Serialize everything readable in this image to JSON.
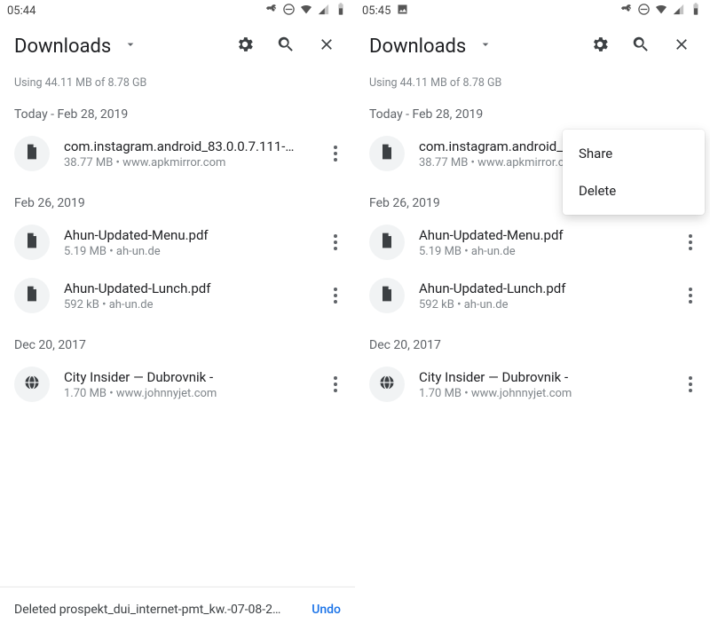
{
  "screens": [
    {
      "status": {
        "time": "05:44",
        "has_image_badge": false
      },
      "popup_visible": false,
      "snackbar_visible": true
    },
    {
      "status": {
        "time": "05:45",
        "has_image_badge": true
      },
      "popup_visible": true,
      "snackbar_visible": false
    }
  ],
  "toolbar": {
    "title": "Downloads"
  },
  "storage_line": "Using 44.11 MB of 8.78 GB",
  "popup": {
    "items": [
      "Share",
      "Delete"
    ]
  },
  "snackbar": {
    "text": "Deleted prospekt_dui_internet-pmt_kw.-07-08-2…",
    "action": "Undo"
  },
  "groups": [
    {
      "label": "Today - Feb 28, 2019",
      "files": [
        {
          "icon": "file",
          "name": "com.instagram.android_83.0.0.7.111-…",
          "size": "38.77 MB",
          "source": "www.apkmirror.com"
        }
      ]
    },
    {
      "label": "Feb 26, 2019",
      "files": [
        {
          "icon": "file",
          "name": "Ahun-Updated-Menu.pdf",
          "size": "5.19 MB",
          "source": "ah-un.de"
        },
        {
          "icon": "file",
          "name": "Ahun-Updated-Lunch.pdf",
          "size": "592 kB",
          "source": "ah-un.de"
        }
      ]
    },
    {
      "label": "Dec 20, 2017",
      "files": [
        {
          "icon": "globe",
          "name": "City Insider — Dubrovnik -",
          "size": "1.70 MB",
          "source": "www.johnnyjet.com"
        }
      ]
    }
  ]
}
